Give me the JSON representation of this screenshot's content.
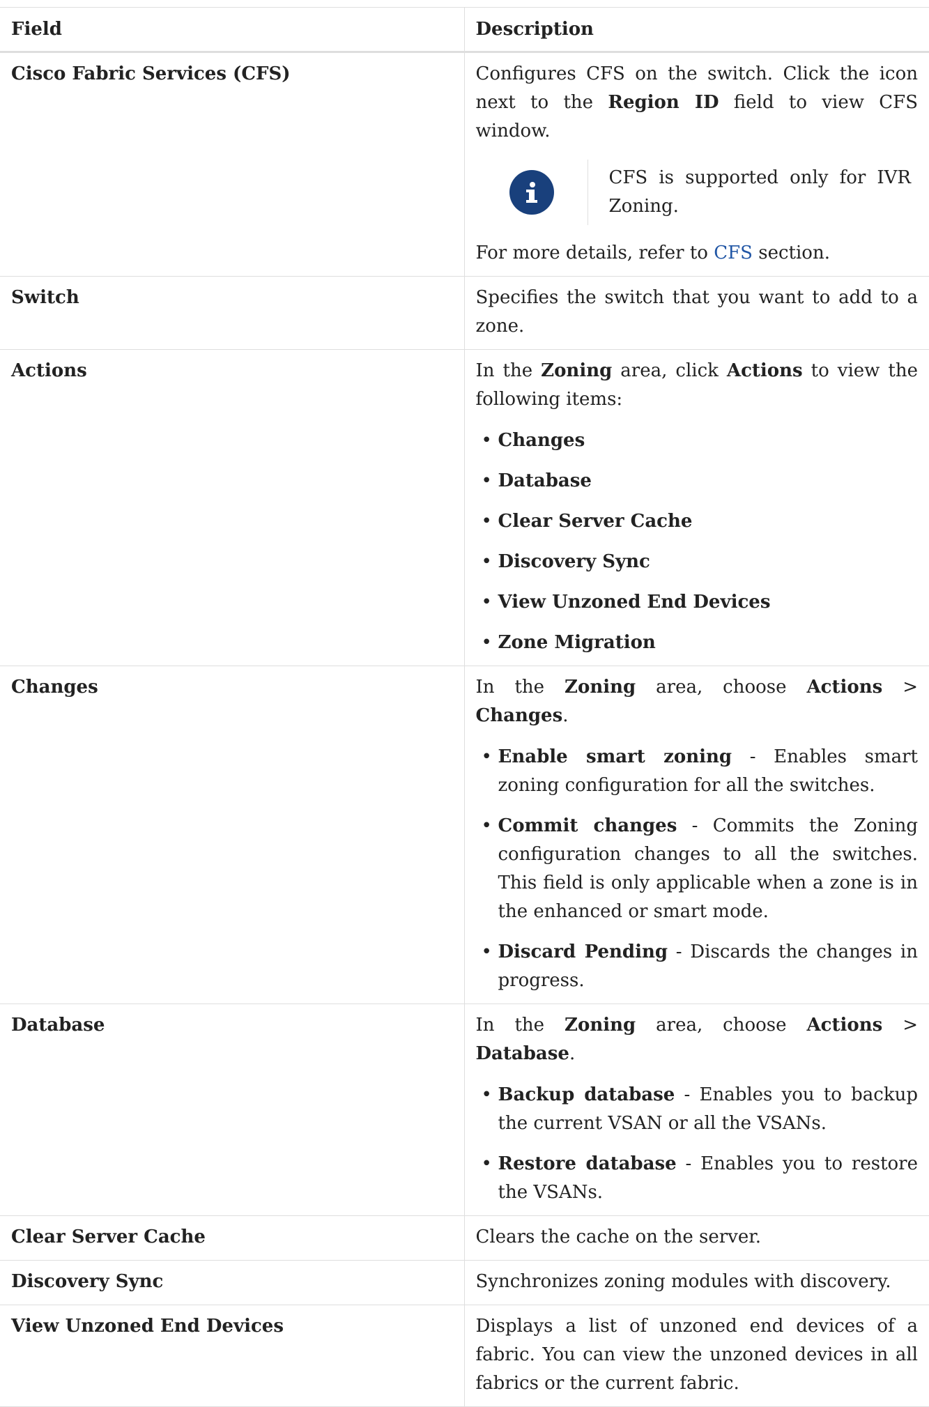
{
  "table": {
    "header": {
      "field": "Field",
      "description": "Description"
    },
    "rows": {
      "cfs": {
        "field": "Cisco Fabric Services (CFS)",
        "p1_a": "Configures CFS on the switch. Click the icon next to the ",
        "p1_b": "Region ID",
        "p1_c": " field to view CFS window.",
        "note": "CFS is supported only for IVR Zoning.",
        "icon": "info-icon",
        "p2_a": "For more details, refer to ",
        "p2_link": "CFS",
        "p2_b": " section."
      },
      "switch": {
        "field": "Switch",
        "desc": "Specifies the switch that you want to add to a zone."
      },
      "actions": {
        "field": "Actions",
        "p_a": "In the ",
        "p_b": "Zoning",
        "p_c": " area, click ",
        "p_d": "Actions",
        "p_e": " to view the following items:",
        "items": [
          "Changes",
          "Database",
          "Clear Server Cache",
          "Discovery Sync",
          "View Unzoned End Devices",
          "Zone Migration"
        ]
      },
      "changes": {
        "field": "Changes",
        "p_a": "In the ",
        "p_b": "Zoning",
        "p_c": " area, choose ",
        "p_d": "Actions",
        "p_e": " > ",
        "p_f": "Changes",
        "p_g": ".",
        "items": [
          {
            "term": "Enable smart zoning",
            "text": " - Enables smart zoning configuration for all the switches."
          },
          {
            "term": "Commit changes",
            "text": " - Commits the Zoning configuration changes to all the switches. This field is only applicable when a zone is in the enhanced or smart mode."
          },
          {
            "term": "Discard Pending",
            "text": " - Discards the changes in progress."
          }
        ]
      },
      "database": {
        "field": "Database",
        "p_a": "In the ",
        "p_b": "Zoning",
        "p_c": " area, choose ",
        "p_d": "Actions",
        "p_e": " > ",
        "p_f": "Database",
        "p_g": ".",
        "items": [
          {
            "term": "Backup database",
            "text": " - Enables you to backup the current VSAN or all the VSANs."
          },
          {
            "term": "Restore database",
            "text": " - Enables you to restore the VSANs."
          }
        ]
      },
      "clear_cache": {
        "field": "Clear Server Cache",
        "desc": "Clears the cache on the server."
      },
      "discovery_sync": {
        "field": "Discovery Sync",
        "desc": "Synchronizes zoning modules with discovery."
      },
      "unzoned": {
        "field": "View Unzoned End Devices",
        "desc": "Displays a list of unzoned end devices of a fabric. You can view the unzoned devices in all fabrics or the current fabric."
      }
    }
  }
}
